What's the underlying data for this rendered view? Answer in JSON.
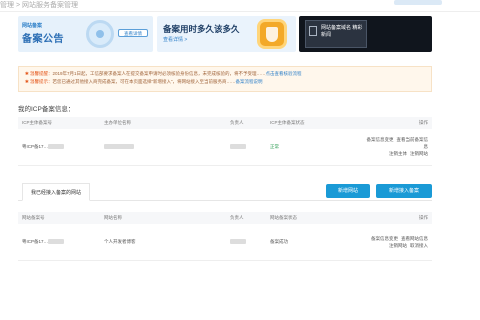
{
  "topbar": {
    "title": "管理 > 网站服务备案管理"
  },
  "banners": {
    "b1": {
      "kicker": "网站备案",
      "title": "备案公告",
      "pill": "查看详情"
    },
    "b2": {
      "title": "备案用时多久该多久",
      "link": "查看详情 >"
    },
    "b3": {
      "text": "网站备案域名 精彩新闻"
    }
  },
  "notice": {
    "line1_prefix": "✱ 温馨提醒：",
    "line1": "2019年7月1日起，工信部要求备案人在提交备案申请时必须核验身份信息，未完成核验的，将不予受理……",
    "line1_link": "点击查看核验流程",
    "line2_prefix": "✱ 温馨提示：",
    "line2": "若您已通过其他接入商完成备案，可在本页面选择“新增接入”，将网站接入至当前服务商……",
    "line2_link": "备案流程说明"
  },
  "section": {
    "title": "我的ICP备案信息："
  },
  "icp_table": {
    "headers": [
      "ICP主体备案号",
      "主办单位名称",
      "负责人",
      "ICP主体备案状态",
      "操作"
    ],
    "row": {
      "no": "粤ICP备17…",
      "org": "",
      "person": "",
      "status": "正常",
      "ops": [
        "备案信息变更",
        "查看当前备案信息",
        "注销主体",
        "注销网站"
      ]
    }
  },
  "tabs": {
    "active": "我已经接入备案的网站"
  },
  "buttons": {
    "new_site": "新增网站",
    "new_access": "新增接入备案"
  },
  "site_table": {
    "headers": [
      "网站备案号",
      "网站名称",
      "负责人",
      "网站备案状态",
      "操作"
    ],
    "row": {
      "no": "粤ICP备17…",
      "name": "个人开发者博客",
      "person": "",
      "status": "备案成功",
      "ops": [
        "备案信息变更",
        "查看网站信息",
        "注销网站",
        "取消接入"
      ]
    }
  }
}
